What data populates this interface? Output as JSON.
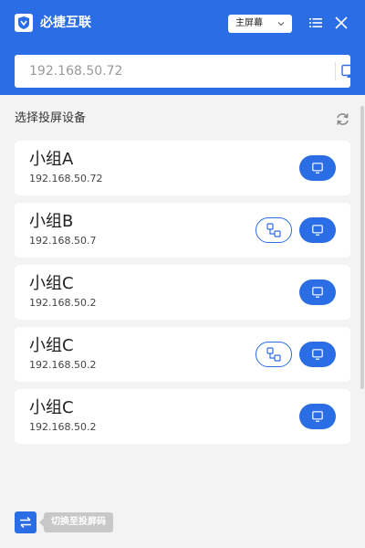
{
  "header": {
    "app_title": "必捷互联",
    "screen_select": "主屏幕",
    "accent_color": "#2b6de5"
  },
  "search": {
    "value": "192.168.50.72"
  },
  "section": {
    "title": "选择投屏设备"
  },
  "devices": [
    {
      "name": "小组A",
      "ip": "192.168.50.72",
      "group_button": false
    },
    {
      "name": "小组B",
      "ip": "192.168.50.7",
      "group_button": true
    },
    {
      "name": "小组C",
      "ip": "192.168.50.2",
      "group_button": false
    },
    {
      "name": "小组C",
      "ip": "192.168.50.2",
      "group_button": true
    },
    {
      "name": "小组C",
      "ip": "192.168.50.2",
      "group_button": false
    }
  ],
  "footer": {
    "switch_label": "切换至投屏码"
  }
}
